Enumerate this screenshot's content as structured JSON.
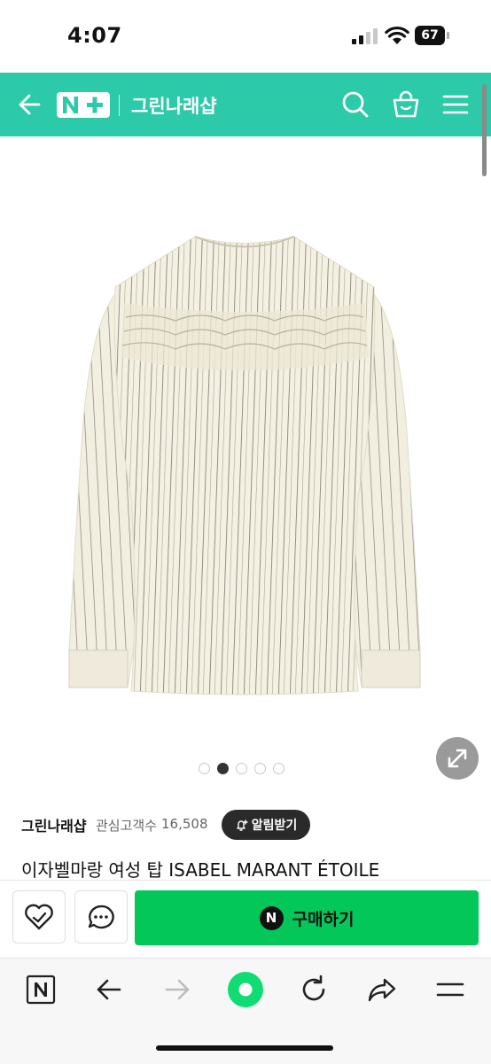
{
  "status_bar": {
    "time": "4:07",
    "battery": "67"
  },
  "header": {
    "logo_text": "N+",
    "shop_name": "그린나래샵",
    "icons": [
      "back-arrow-icon",
      "search-icon",
      "shopping-bag-icon",
      "menu-icon"
    ],
    "accent_color": "#2ccaa9"
  },
  "carousel": {
    "total": 5,
    "active_index": 1
  },
  "seller": {
    "name": "그린나래샵",
    "interest_label": "관심고객수",
    "interest_count": "16,508",
    "alert_button": "알림받기"
  },
  "product": {
    "title": "이자벨마랑 여성 탑 ISABEL MARANT ÉTOILE",
    "image": "ivory-striped-blouse"
  },
  "action_bar": {
    "buy_icon_text": "N",
    "buy_label": "구매하기",
    "buy_color": "#04c75a"
  },
  "browser_toolbar": {
    "icons": [
      "naver-n-icon",
      "back-icon",
      "forward-icon",
      "green-home-icon",
      "reload-icon",
      "share-icon",
      "menu-icon"
    ]
  }
}
